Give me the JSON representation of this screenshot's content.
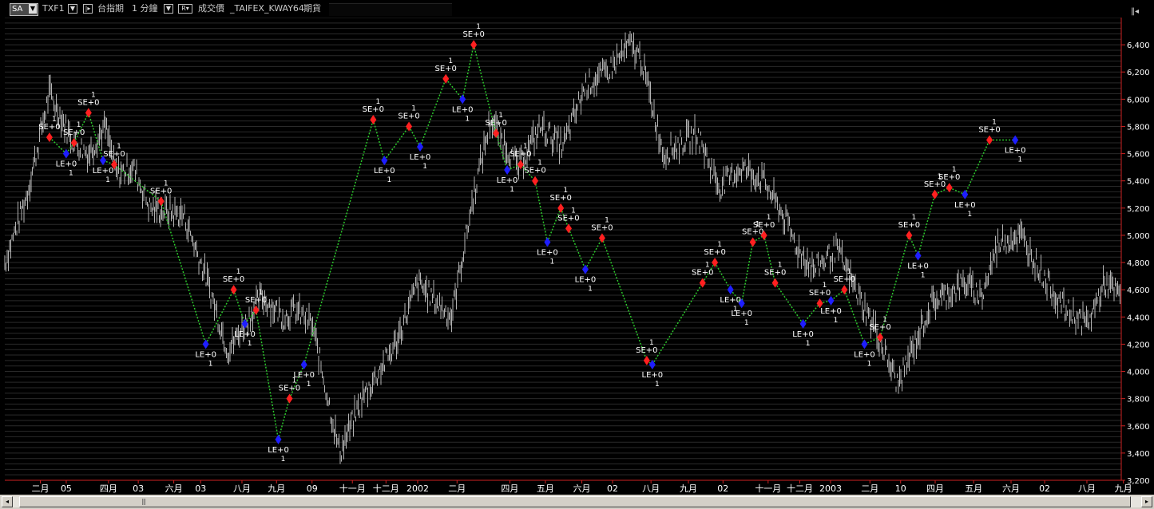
{
  "toolbar": {
    "symbol_selector": "SA",
    "symbol_code": "TXF1",
    "exchange": "台指期",
    "interval": "1 分鐘",
    "dropdown_r": "R",
    "data_type": "成交價",
    "strategy": "_TAIFEX_KWAY64",
    "category": "期貨"
  },
  "colors": {
    "background": "#000000",
    "price_bars": "#b4b4b4",
    "buy_marker": "#1e1eff",
    "sell_marker": "#ff2020",
    "trade_line": "#2cc82c",
    "axis": "#cc2222",
    "grid": "#2a2a2a",
    "labels": "#ffffff"
  },
  "chart_data": {
    "type": "line",
    "ylim": [
      3200,
      6600
    ],
    "y_ticks": [
      3200,
      3400,
      3600,
      3800,
      4000,
      4200,
      4400,
      4600,
      4800,
      5000,
      5200,
      5400,
      5600,
      5800,
      6000,
      6200,
      6400
    ],
    "x_tick_labels": [
      "二月",
      "05",
      "四月",
      "03",
      "六月",
      "03",
      "八月",
      "九月",
      "09",
      "十一月",
      "十二月",
      "2002",
      "二月",
      "四月",
      "五月",
      "六月",
      "02",
      "八月",
      "九月",
      "02",
      "十一月",
      "十二月",
      "2003",
      "二月",
      "10",
      "四月",
      "五月",
      "六月",
      "02",
      "八月",
      "九月"
    ],
    "x_tick_positions": [
      0.037,
      0.064,
      0.108,
      0.139,
      0.176,
      0.204,
      0.247,
      0.283,
      0.32,
      0.362,
      0.397,
      0.43,
      0.471,
      0.526,
      0.563,
      0.601,
      0.633,
      0.673,
      0.712,
      0.748,
      0.795,
      0.828,
      0.86,
      0.901,
      0.933,
      0.969,
      1.009,
      1.048,
      1.083,
      1.127,
      1.165
    ],
    "x": [
      0,
      0.02,
      0.04,
      0.06,
      0.075,
      0.09,
      0.1,
      0.115,
      0.13,
      0.16,
      0.18,
      0.2,
      0.23,
      0.25,
      0.26,
      0.275,
      0.3,
      0.32,
      0.335,
      0.35,
      0.37,
      0.4,
      0.42,
      0.435,
      0.46,
      0.48,
      0.5,
      0.52,
      0.54,
      0.56,
      0.57,
      0.59,
      0.62,
      0.64,
      0.66,
      0.68,
      0.7,
      0.71,
      0.725,
      0.745,
      0.765,
      0.78,
      0.8,
      0.83,
      0.86,
      0.875,
      0.89,
      0.91,
      0.93,
      0.95,
      0.97,
      0.985,
      1.0
    ],
    "series": [
      {
        "values": [
          4800,
          5300,
          6050,
          5700,
          5600,
          5800,
          5450,
          5500,
          5200,
          5150,
          4700,
          4150,
          4550,
          4400,
          4450,
          4350,
          3400,
          3800,
          4000,
          4200,
          4650,
          4400,
          5300,
          5850,
          5500,
          5800,
          5650,
          6100,
          6200,
          6400,
          6300,
          5600,
          5750,
          5350,
          5500,
          5400,
          5100,
          4900,
          4750,
          4900,
          4550,
          4300,
          3900,
          4500,
          4650,
          4550,
          4950,
          5000,
          4700,
          4450,
          4350,
          4650,
          4550
        ]
      }
    ],
    "annotation_labels": [
      "SE+0",
      "LE+0",
      "1"
    ],
    "trades": [
      {
        "x": 0.04,
        "y": 5720,
        "side": "sell"
      },
      {
        "x": 0.055,
        "y": 5600,
        "side": "buy"
      },
      {
        "x": 0.062,
        "y": 5680,
        "side": "sell"
      },
      {
        "x": 0.075,
        "y": 5900,
        "side": "sell"
      },
      {
        "x": 0.088,
        "y": 5550,
        "side": "buy"
      },
      {
        "x": 0.098,
        "y": 5520,
        "side": "sell"
      },
      {
        "x": 0.14,
        "y": 5250,
        "side": "sell"
      },
      {
        "x": 0.18,
        "y": 4200,
        "side": "buy"
      },
      {
        "x": 0.205,
        "y": 4600,
        "side": "sell"
      },
      {
        "x": 0.215,
        "y": 4350,
        "side": "buy"
      },
      {
        "x": 0.225,
        "y": 4450,
        "side": "sell"
      },
      {
        "x": 0.245,
        "y": 3500,
        "side": "buy"
      },
      {
        "x": 0.255,
        "y": 3800,
        "side": "sell"
      },
      {
        "x": 0.268,
        "y": 4050,
        "side": "buy"
      },
      {
        "x": 0.33,
        "y": 5850,
        "side": "sell"
      },
      {
        "x": 0.34,
        "y": 5550,
        "side": "buy"
      },
      {
        "x": 0.362,
        "y": 5800,
        "side": "sell"
      },
      {
        "x": 0.372,
        "y": 5650,
        "side": "buy"
      },
      {
        "x": 0.395,
        "y": 6150,
        "side": "sell"
      },
      {
        "x": 0.41,
        "y": 6000,
        "side": "buy"
      },
      {
        "x": 0.42,
        "y": 6400,
        "side": "sell"
      },
      {
        "x": 0.44,
        "y": 5750,
        "side": "sell"
      },
      {
        "x": 0.45,
        "y": 5480,
        "side": "buy"
      },
      {
        "x": 0.462,
        "y": 5520,
        "side": "sell"
      },
      {
        "x": 0.475,
        "y": 5400,
        "side": "sell"
      },
      {
        "x": 0.486,
        "y": 4950,
        "side": "buy"
      },
      {
        "x": 0.498,
        "y": 5200,
        "side": "sell"
      },
      {
        "x": 0.505,
        "y": 5050,
        "side": "sell"
      },
      {
        "x": 0.52,
        "y": 4750,
        "side": "buy"
      },
      {
        "x": 0.535,
        "y": 4980,
        "side": "sell"
      },
      {
        "x": 0.575,
        "y": 4080,
        "side": "sell"
      },
      {
        "x": 0.58,
        "y": 4050,
        "side": "buy"
      },
      {
        "x": 0.625,
        "y": 4650,
        "side": "sell"
      },
      {
        "x": 0.636,
        "y": 4800,
        "side": "sell"
      },
      {
        "x": 0.65,
        "y": 4600,
        "side": "buy"
      },
      {
        "x": 0.66,
        "y": 4500,
        "side": "buy"
      },
      {
        "x": 0.67,
        "y": 4950,
        "side": "sell"
      },
      {
        "x": 0.68,
        "y": 5000,
        "side": "sell"
      },
      {
        "x": 0.69,
        "y": 4650,
        "side": "sell"
      },
      {
        "x": 0.715,
        "y": 4350,
        "side": "buy"
      },
      {
        "x": 0.73,
        "y": 4500,
        "side": "sell"
      },
      {
        "x": 0.74,
        "y": 4520,
        "side": "buy"
      },
      {
        "x": 0.752,
        "y": 4600,
        "side": "sell"
      },
      {
        "x": 0.77,
        "y": 4200,
        "side": "buy"
      },
      {
        "x": 0.784,
        "y": 4250,
        "side": "sell"
      },
      {
        "x": 0.81,
        "y": 5000,
        "side": "sell"
      },
      {
        "x": 0.818,
        "y": 4850,
        "side": "buy"
      },
      {
        "x": 0.833,
        "y": 5300,
        "side": "sell"
      },
      {
        "x": 0.846,
        "y": 5350,
        "side": "sell"
      },
      {
        "x": 0.86,
        "y": 5300,
        "side": "buy"
      },
      {
        "x": 0.882,
        "y": 5700,
        "side": "sell"
      },
      {
        "x": 0.905,
        "y": 5700,
        "side": "buy"
      }
    ]
  }
}
